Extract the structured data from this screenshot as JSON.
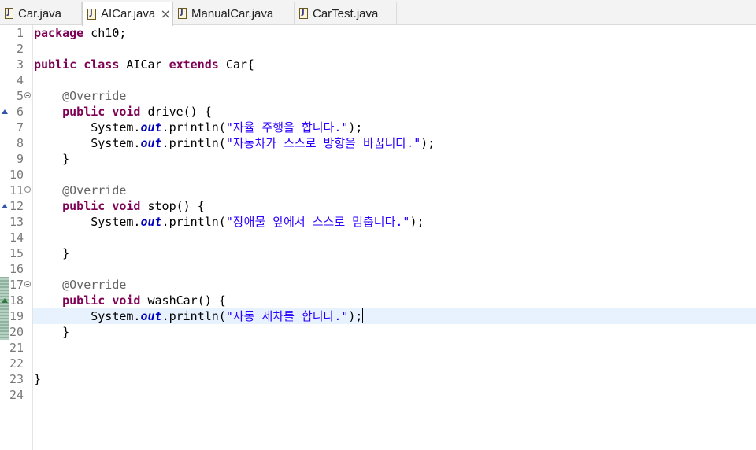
{
  "tabs": [
    {
      "label": "Car.java",
      "active": false,
      "closable": false
    },
    {
      "label": "AICar.java",
      "active": true,
      "closable": true
    },
    {
      "label": "ManualCar.java",
      "active": false,
      "closable": false
    },
    {
      "label": "CarTest.java",
      "active": false,
      "closable": false
    }
  ],
  "tab_close_glyph": "×",
  "code": {
    "line_numbers": [
      "1",
      "2",
      "3",
      "4",
      "5",
      "6",
      "7",
      "8",
      "9",
      "10",
      "11",
      "12",
      "13",
      "14",
      "15",
      "16",
      "17",
      "18",
      "19",
      "20",
      "21",
      "22",
      "23",
      "24"
    ],
    "l1_kw": "package",
    "l1_rest": " ch10;",
    "l3_kw1": "public",
    "l3_kw2": "class",
    "l3_name": "AICar",
    "l3_kw3": "extends",
    "l3_rest": "Car{",
    "l5_ann": "@Override",
    "l6_kw1": "public",
    "l6_kw2": "void",
    "l6_rest": "drive() {",
    "sys": "System.",
    "out": "out",
    "println": ".println(",
    "l7_str": "\"자율 주행을 합니다.\"",
    "l8_str": "\"자동차가 스스로 방향을 바꿉니다.\"",
    "end_stmt": ");",
    "close_brace": "}",
    "l11_ann": "@Override",
    "l12_kw1": "public",
    "l12_kw2": "void",
    "l12_rest": "stop() {",
    "l13_str": "\"장애물 앞에서 스스로 멈춥니다.\"",
    "l17_ann": "@Override",
    "l18_kw1": "public",
    "l18_kw2": "void",
    "l18_rest": "washCar() {",
    "l19_str": "\"자동 세차를 합니다.\""
  },
  "icons": {
    "java_file": "java-file-icon",
    "fold": "fold-collapse-icon",
    "override": "override-marker-icon"
  },
  "colors": {
    "keyword": "#7f0055",
    "annotation": "#646464",
    "field": "#0000c0",
    "string": "#2a00ff",
    "current_line": "#e8f2fe"
  }
}
